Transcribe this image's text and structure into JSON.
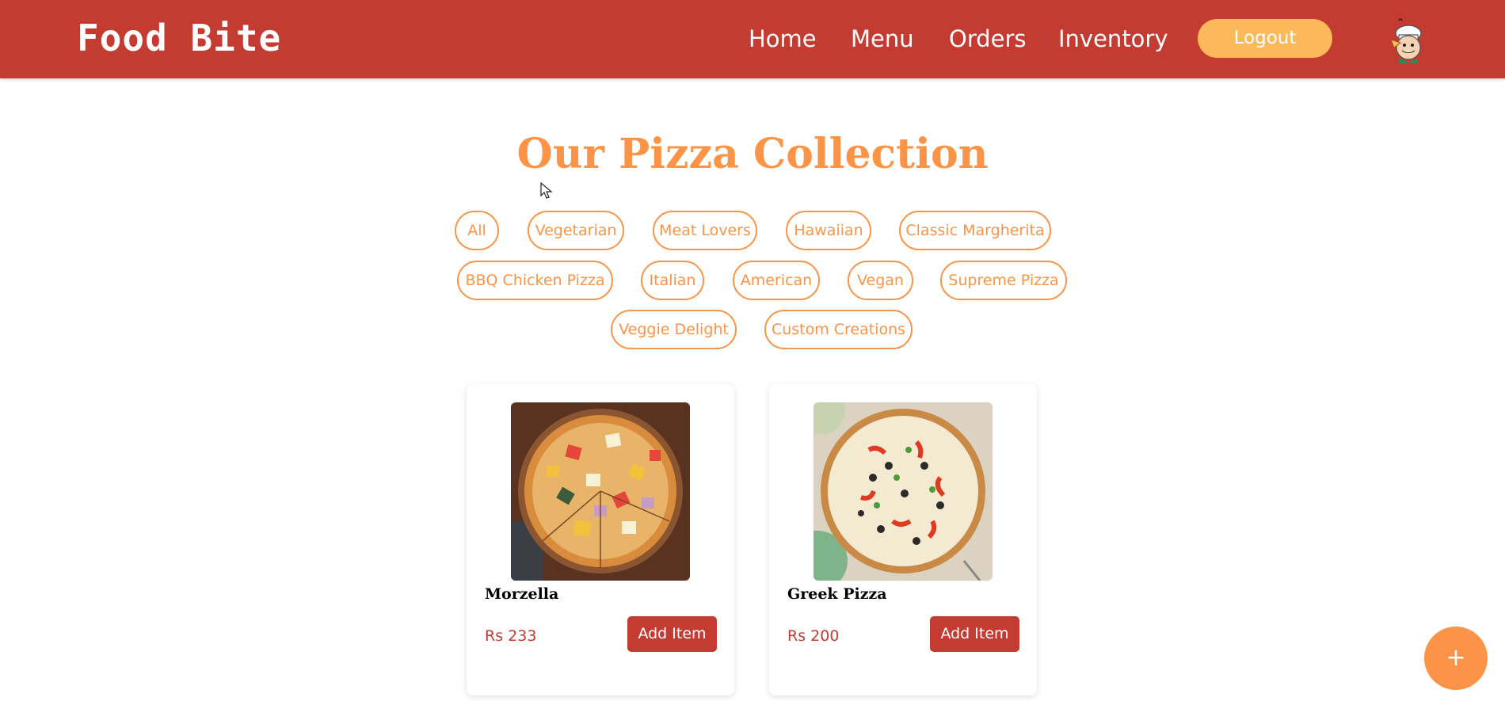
{
  "brand": {
    "name": "Food Bite"
  },
  "nav": {
    "links": [
      "Home",
      "Menu",
      "Orders",
      "Inventory"
    ],
    "logout_label": "Logout"
  },
  "page": {
    "title": "Our Pizza Collection"
  },
  "filters": [
    "All",
    "Vegetarian",
    "Meat Lovers",
    "Hawaiian",
    "Classic Margherita",
    "BBQ Chicken Pizza",
    "Italian",
    "American",
    "Vegan",
    "Supreme Pizza",
    "Veggie Delight",
    "Custom Creations"
  ],
  "items": [
    {
      "name": "Morzella",
      "price": "Rs 233",
      "button": "Add Item"
    },
    {
      "name": "Greek Pizza",
      "price": "Rs 200",
      "button": "Add Item"
    }
  ],
  "fab": {
    "label": "+"
  },
  "colors": {
    "brand": "#c43b31",
    "accent": "#fb9447",
    "logout": "#fdb85a"
  },
  "icons": {
    "avatar": "chef-avatar-icon",
    "cursor": "mouse-pointer-icon",
    "add": "plus-icon"
  }
}
